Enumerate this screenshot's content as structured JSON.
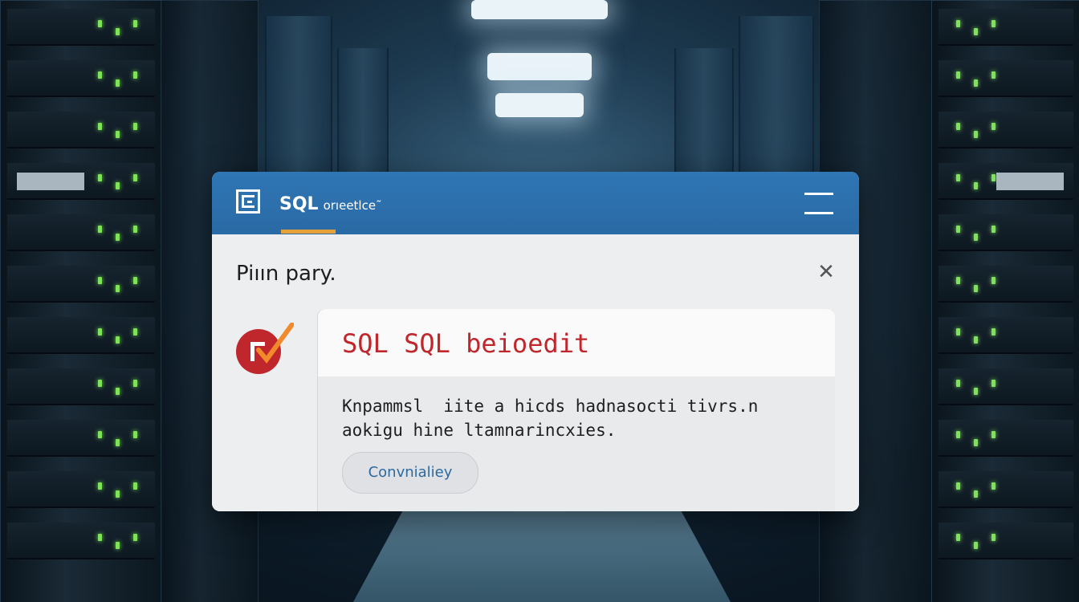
{
  "app": {
    "title": "SQL",
    "subtitle": "orıeetlce˜"
  },
  "dialog": {
    "heading": "Piıın pary.",
    "close_symbol": "✕",
    "card": {
      "title": "SQL SQL beioedit",
      "message": "Knpammsl  iite a hicds hadnasocti tivrs.n\naokigu hine ltamnarincxies.",
      "button_label": "Convnialiey"
    }
  },
  "icons": {
    "app_logo": "database-logo-icon",
    "menu": "hamburger-menu-icon",
    "close": "close-icon",
    "status": "warning-check-badge-icon"
  },
  "colors": {
    "titlebar": "#2f76b5",
    "accent_underline": "#e5a23a",
    "error_red": "#c0272d",
    "check_orange": "#f08a2a",
    "button_text": "#2c6aa0",
    "rack_led": "#7ee35a"
  }
}
